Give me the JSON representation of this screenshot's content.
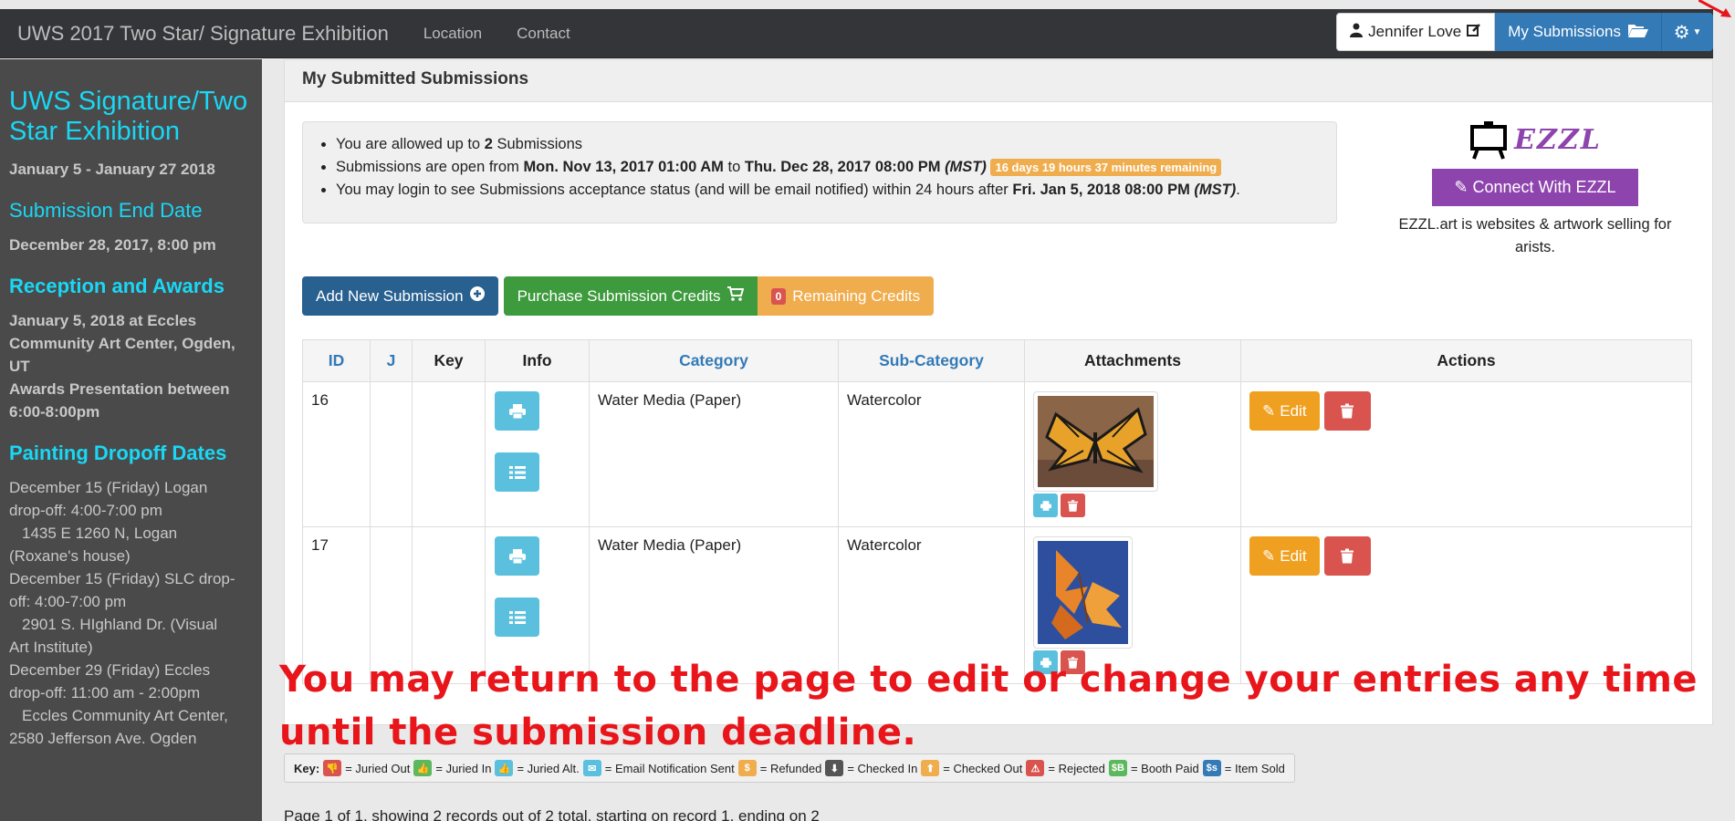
{
  "navbar": {
    "brand": "UWS 2017 Two Star/ Signature Exhibition",
    "links": [
      "Location",
      "Contact"
    ],
    "user": "Jennifer Love",
    "submissions": "My Submissions"
  },
  "sidebar": {
    "title": "UWS Signature/Two Star Exhibition",
    "dates": "January 5 - January 27 2018",
    "end_heading": "Submission End Date",
    "end_date": "December 28, 2017, 8:00 pm",
    "reception_heading": "Reception and Awards",
    "reception_lines": [
      "January 5, 2018 at Eccles",
      "Community Art Center, Ogden,",
      "UT",
      "Awards Presentation between",
      "6:00-8:00pm"
    ],
    "dropoff_heading": "Painting Dropoff Dates",
    "dropoff_lines": [
      "December 15 (Friday) Logan",
      "drop-off:  4:00-7:00 pm",
      "1435 E 1260 N, Logan",
      "(Roxane's house)",
      "December 15 (Friday) SLC drop-",
      "off: 4:00-7:00 pm",
      "2901 S. HIghland Dr. (Visual",
      "Art Institute)",
      "December 29 (Friday) Eccles",
      "drop-off: 11:00 am - 2:00pm",
      "Eccles Community Art Center,",
      "2580 Jefferson Ave. Ogden"
    ]
  },
  "panel": {
    "heading": "My Submitted Submissions",
    "info": {
      "line1_pre": "You are allowed up to ",
      "line1_num": "2",
      "line1_post": " Submissions",
      "line2_pre": "Submissions are open from ",
      "open_date": "Mon. Nov 13, 2017 01:00 AM",
      "line2_mid": " to ",
      "close_date": "Thu. Dec 28, 2017 08:00 PM",
      "tz": "(MST)",
      "remaining": "16 days 19 hours 37 minutes remaining",
      "line3_pre": "You may login to see Submissions acceptance status (and will be email notified) within 24 hours after ",
      "status_date": "Fri. Jan 5, 2018 08:00 PM",
      "line3_post": "."
    },
    "ezzl": {
      "logo_word": "EZZL",
      "connect": "Connect With EZZL",
      "blurb": "EZZL.art is websites & artwork selling for arists."
    },
    "buttons": {
      "add": "Add New Submission",
      "purchase": "Purchase Submission Credits",
      "credits_count": "0",
      "credits_label": "Remaining Credits"
    },
    "table": {
      "headers": [
        "ID",
        "J",
        "Key",
        "Info",
        "Category",
        "Sub-Category",
        "Attachments",
        "Actions"
      ],
      "rows": [
        {
          "id": "16",
          "category": "Water Media (Paper)",
          "subcategory": "Watercolor",
          "edit": "Edit"
        },
        {
          "id": "17",
          "category": "Water Media (Paper)",
          "subcategory": "Watercolor",
          "edit": "Edit"
        }
      ]
    }
  },
  "overlay": "You may return to the page to edit or change your entries any time until the submission deadline.",
  "key": {
    "label": "Key:",
    "items": [
      {
        "text": "= Juried Out",
        "color": "#d9534f",
        "chip": "👎"
      },
      {
        "text": "= Juried In",
        "color": "#5cb85c",
        "chip": "👍"
      },
      {
        "text": "= Juried Alt.",
        "color": "#5bc0de",
        "chip": "👍"
      },
      {
        "text": "= Email Notification Sent",
        "color": "#5bc0de",
        "chip": "✉"
      },
      {
        "text": "= Refunded",
        "color": "#f0ad4e",
        "chip": "$"
      },
      {
        "text": "= Checked In",
        "color": "#555555",
        "chip": "⬇"
      },
      {
        "text": "= Checked Out",
        "color": "#f0ad4e",
        "chip": "⬆"
      },
      {
        "text": "= Rejected",
        "color": "#d9534f",
        "chip": "⚠"
      },
      {
        "text": "= Booth Paid",
        "color": "#5cb85c",
        "chip": "$B"
      },
      {
        "text": "= Item Sold",
        "color": "#337ab7",
        "chip": "$s"
      }
    ]
  },
  "pageinfo": "Page 1 of 1, showing 2 records out of 2 total, starting on record 1, ending on 2"
}
